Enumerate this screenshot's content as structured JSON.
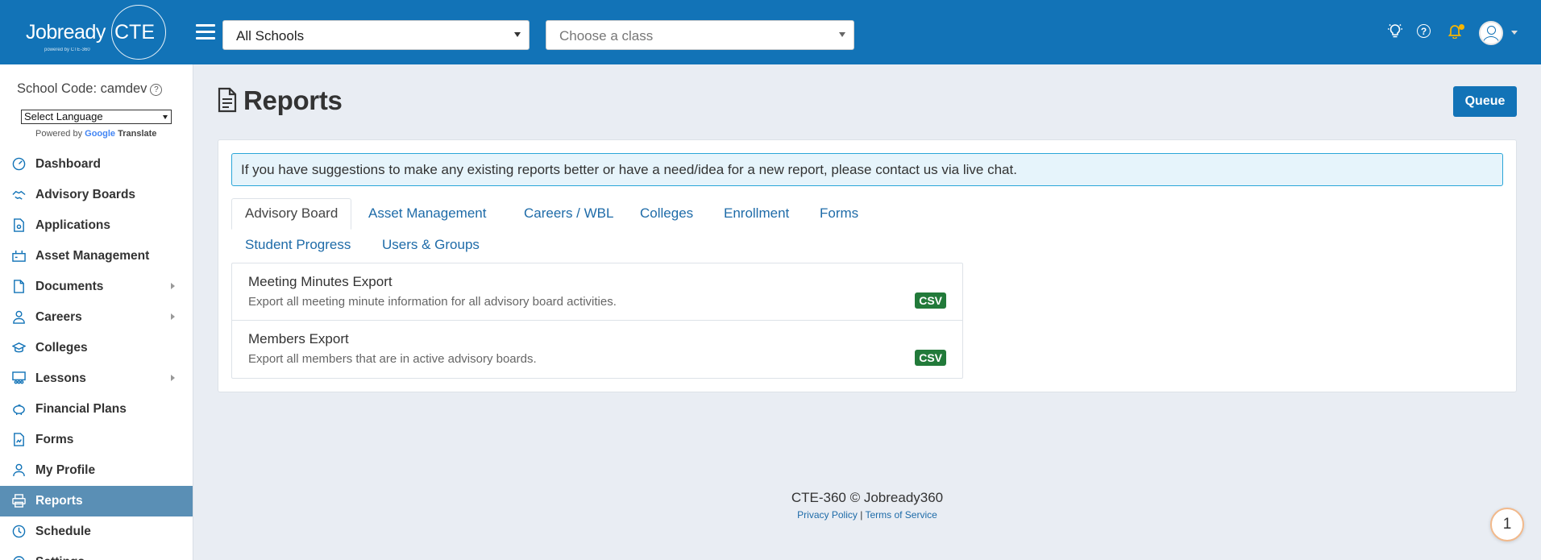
{
  "header": {
    "logo_text_a": "Jobready",
    "logo_text_b": "CTE",
    "logo_subtext": "powered by CTE-360",
    "school_select": "All Schools",
    "class_select_placeholder": "Choose a class",
    "help_glyph": "?"
  },
  "sidebar": {
    "school_code": "School Code: camdev",
    "help_glyph": "?",
    "language_select": "Select Language",
    "powered_by": "Powered by",
    "google": "Google",
    "translate": "Translate",
    "items": [
      {
        "label": "Dashboard",
        "icon": "dashboard-icon",
        "has_submenu": false
      },
      {
        "label": "Advisory Boards",
        "icon": "handshake-icon",
        "has_submenu": false
      },
      {
        "label": "Applications",
        "icon": "application-icon",
        "has_submenu": false
      },
      {
        "label": "Asset Management",
        "icon": "asset-icon",
        "has_submenu": false
      },
      {
        "label": "Documents",
        "icon": "document-icon",
        "has_submenu": true
      },
      {
        "label": "Careers",
        "icon": "careers-icon",
        "has_submenu": true
      },
      {
        "label": "Colleges",
        "icon": "graduation-cap-icon",
        "has_submenu": false
      },
      {
        "label": "Lessons",
        "icon": "lessons-icon",
        "has_submenu": true
      },
      {
        "label": "Financial Plans",
        "icon": "piggy-bank-icon",
        "has_submenu": false
      },
      {
        "label": "Forms",
        "icon": "forms-icon",
        "has_submenu": false
      },
      {
        "label": "My Profile",
        "icon": "profile-icon",
        "has_submenu": false
      },
      {
        "label": "Reports",
        "icon": "printer-icon",
        "has_submenu": false,
        "active": true
      },
      {
        "label": "Schedule",
        "icon": "clock-icon",
        "has_submenu": false
      },
      {
        "label": "Settings",
        "icon": "settings-icon",
        "has_submenu": false
      }
    ]
  },
  "main": {
    "page_title": "Reports",
    "queue_button": "Queue",
    "alert": "If you have suggestions to make any existing reports better or have a need/idea for a new report, please contact us via live chat.",
    "tabs": [
      {
        "label": "Advisory Board",
        "active": true
      },
      {
        "label": "Asset Management"
      },
      {
        "label": "Careers / WBL"
      },
      {
        "label": "Colleges"
      },
      {
        "label": "Enrollment"
      },
      {
        "label": "Forms"
      },
      {
        "label": "Student Progress"
      },
      {
        "label": "Users & Groups"
      }
    ],
    "reports": [
      {
        "title": "Meeting Minutes Export",
        "description": "Export all meeting minute information for all advisory board activities.",
        "format": "CSV"
      },
      {
        "title": "Members Export",
        "description": "Export all members that are in active advisory boards.",
        "format": "CSV"
      }
    ]
  },
  "footer": {
    "copyright": "CTE-360 © Jobready360",
    "privacy": "Privacy Policy",
    "separator": "|",
    "terms": "Terms of Service"
  },
  "floating_badge": "1",
  "colors": {
    "header_bg": "#1273b7",
    "active_nav": "#5a8fb5",
    "csv_badge": "#227a3a",
    "alert_bg": "#e6f4fb"
  }
}
